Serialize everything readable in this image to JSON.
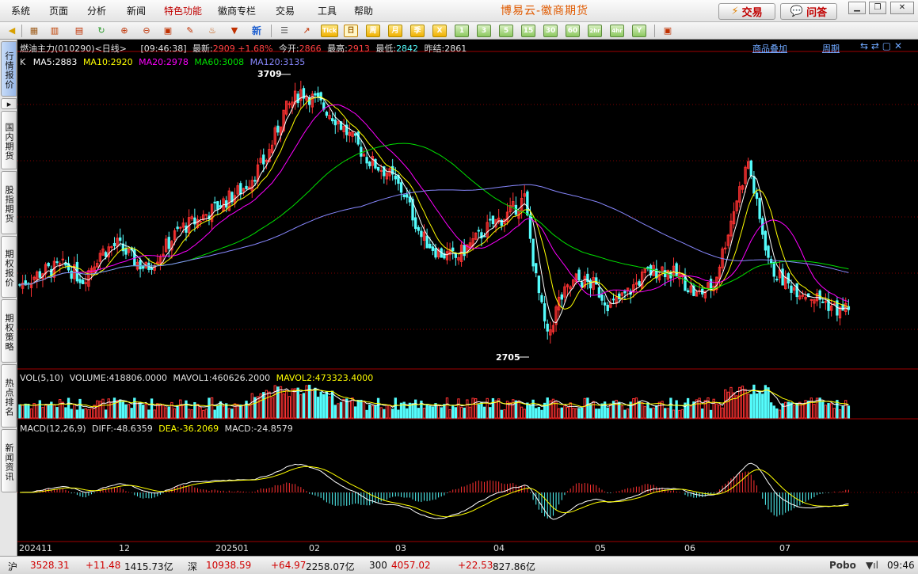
{
  "menu": {
    "items": [
      "系统",
      "页面",
      "分析",
      "新闻",
      "特色功能",
      "徽商专栏",
      "交易",
      "工具",
      "帮助"
    ],
    "highlight_index": 4,
    "app_title": "博易云-徽商期货",
    "trade_button": "交易",
    "qa_button": "问答"
  },
  "toolbar": {
    "periods": [
      "日",
      "周",
      "月",
      "季",
      "X",
      "1",
      "3",
      "5",
      "15",
      "30",
      "60",
      "2hr",
      "4hr",
      "Y"
    ],
    "selected_period": "日",
    "tick_label": "Tick",
    "new_label": "新"
  },
  "sidebar": {
    "tabs": [
      "行情报价",
      "国内期货",
      "股指期货",
      "期权报价",
      "期权策略",
      "热点排名",
      "新闻资讯"
    ]
  },
  "chart": {
    "header": {
      "symbol": "燃油主力(010290)<日线>",
      "time": "[09:46:38]",
      "latest_label": "最新:",
      "latest": "2909",
      "change": "+1.68%",
      "open_label": "今开:",
      "open": "2866",
      "high_label": "最高:",
      "high": "2913",
      "low_label": "最低:",
      "low": "2842",
      "prev_label": "昨结:",
      "prev": "2861",
      "overlay_link": "商品叠加",
      "period_link": "周期"
    },
    "ma": {
      "k_label": "K",
      "ma5": "MA5:2883",
      "ma10": "MA10:2920",
      "ma20": "MA20:2978",
      "ma60": "MA60:3008",
      "ma120": "MA120:3135"
    },
    "marks": {
      "high": "3709",
      "low": "2705"
    },
    "volume": {
      "label": "VOL(5,10)",
      "vol": "VOLUME:418806.0000",
      "mavol1": "MAVOL1:460626.2000",
      "mavol2": "MAVOL2:473323.4000"
    },
    "macd": {
      "label": "MACD(12,26,9)",
      "diff": "DIFF:-48.6359",
      "dea": "DEA:-36.2069",
      "macd": "MACD:-24.8579"
    },
    "x_ticks": [
      "202411",
      "12",
      "202501",
      "02",
      "03",
      "04",
      "05",
      "06",
      "07"
    ],
    "colors": {
      "up": "#ff3232",
      "down": "#54fcfc",
      "ma5": "#ffffff",
      "ma10": "#ffff00",
      "ma20": "#ff00ff",
      "ma60": "#00e000",
      "ma120": "#8888ff"
    }
  },
  "chart_data": {
    "type": "candlestick",
    "x_ticks": [
      "202411",
      "12",
      "202501",
      "02",
      "03",
      "04",
      "05",
      "06",
      "07"
    ],
    "high_mark": 3709,
    "low_mark": 2705,
    "last_close": 2909
  },
  "statusbar": {
    "sh_label": "沪",
    "sh_index": "3528.31",
    "sh_change": "+11.48",
    "sh_amount": "1415.73亿",
    "sz_label": "深",
    "sz_index": "10938.59",
    "sz_change": "+64.97",
    "sz_amount": "2258.07亿",
    "c300_label": "300",
    "c300_index": "4057.02",
    "c300_change": "+22.53",
    "c300_amount": "827.86亿",
    "brand": "Pobo",
    "clock": "09:46"
  }
}
